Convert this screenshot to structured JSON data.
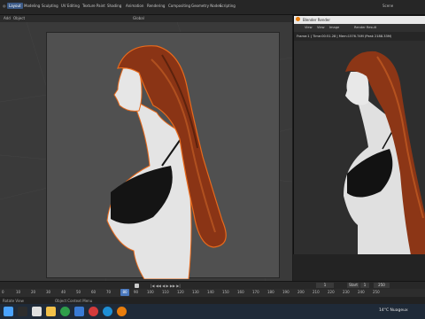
{
  "topbar": {
    "workspaces": [
      "Layout",
      "Modeling",
      "Sculpting",
      "UV Editing",
      "Texture Paint",
      "Shading",
      "Animation",
      "Rendering",
      "Compositing",
      "Geometry Nodes",
      "Scripting"
    ],
    "scene_label": "Scene"
  },
  "header2": {
    "add": "Add",
    "object": "Object",
    "transform": "Global"
  },
  "render_window": {
    "title": "Blender Render",
    "menu": [
      "View",
      "View",
      "Image"
    ],
    "slot": "Render Result",
    "info": "Frame:1 | Time:00:51.28 | Mem:1576.74M (Peak 2188.33M)"
  },
  "timeline": {
    "ruler": [
      "0",
      "10",
      "20",
      "30",
      "40",
      "50",
      "60",
      "70",
      "80",
      "90",
      "100",
      "110",
      "120",
      "130",
      "140",
      "150",
      "160",
      "170",
      "180",
      "190",
      "200",
      "210",
      "220",
      "230",
      "240",
      "250"
    ],
    "current_frame": "1",
    "start_label": "Start",
    "start_value": "1",
    "end_value": "250"
  },
  "status": {
    "left": "Rotate View",
    "middle": "Object Context Menu"
  },
  "taskbar": {
    "weather": "14°C  Nuageux"
  },
  "colors": {
    "accent": "#4a78bd",
    "hair": "#8a3415",
    "selection_outline": "#e86a1c"
  }
}
